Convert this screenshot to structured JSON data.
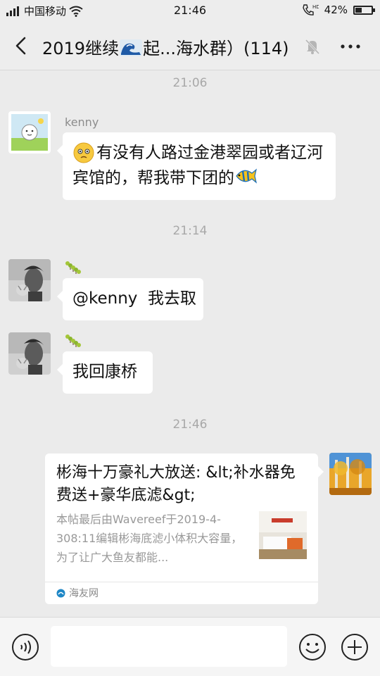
{
  "status_bar": {
    "carrier": "中国移动",
    "time": "21:46",
    "network": "HD",
    "battery": "42%",
    "battery_level": 0.42
  },
  "header": {
    "title_part1": "2019继续",
    "title_part2": "起...海水群）(114)"
  },
  "messages": [
    {
      "time": "21:06"
    },
    {
      "sender": "kenny",
      "text": "有没有人路过金港翠园或者辽河宾馆的，帮我带下团的"
    },
    {
      "time": "21:14"
    },
    {
      "text": "@kenny  我去取"
    },
    {
      "text": "我回康桥"
    },
    {
      "time": "21:46"
    }
  ],
  "link_card": {
    "title": "彬海十万豪礼大放送: &lt;补水器免费送+豪华底滤&gt;",
    "description": "本帖最后由Wavereef于2019-4-308:11编辑彬海底滤小体积大容量，为了让广大鱼友都能...",
    "source": "海友网"
  },
  "colors": {
    "background": "#ebebeb",
    "bubble": "#ffffff",
    "timestamp": "#a8a8a8"
  }
}
